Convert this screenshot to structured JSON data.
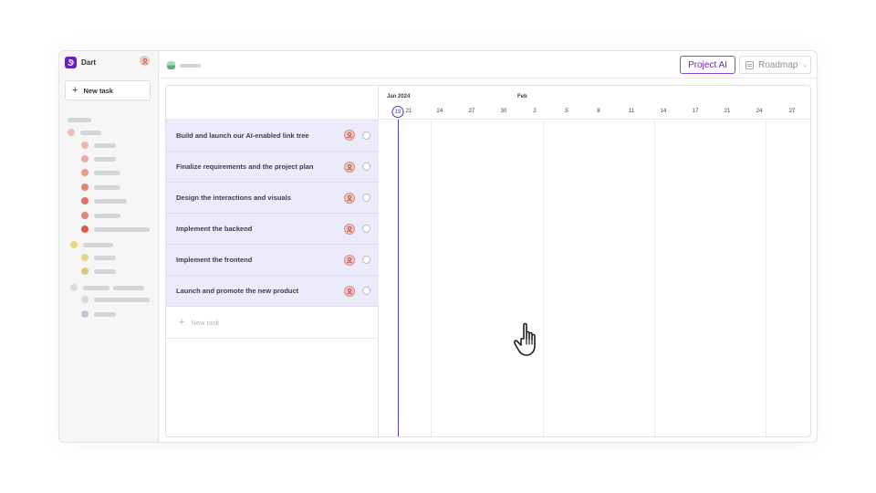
{
  "sidebar": {
    "brand_name": "Dart",
    "new_task_label": "New task",
    "dot_colors": [
      "#f1bcb6",
      "#efb7ae",
      "#edab9f",
      "#e79a8b",
      "#e38676",
      "#e07060",
      "#de5a48",
      "#ebd57a",
      "#e8d583",
      "#ddc77c",
      "#dcdcdf",
      "#d8d9dc",
      "#c5c5d6"
    ]
  },
  "topbar": {
    "project_ai_label": "Project AI",
    "roadmap_label": "Roadmap"
  },
  "tasks": [
    {
      "title": "Build and launch our AI-enabled link tree"
    },
    {
      "title": "Finalize requirements and the project plan"
    },
    {
      "title": "Design the interactions and visuals"
    },
    {
      "title": "Implement the backend"
    },
    {
      "title": "Implement the frontend"
    },
    {
      "title": "Launch and promote the new product"
    }
  ],
  "new_task_row_label": "New task",
  "timeline": {
    "months": [
      {
        "label": "Jan 2024"
      },
      {
        "label": "Feb"
      }
    ],
    "today": "19",
    "days": [
      "21",
      "24",
      "27",
      "30",
      "2",
      "5",
      "8",
      "11",
      "14",
      "17",
      "21",
      "24",
      "27"
    ]
  },
  "colors": {
    "brand": "#6a1fc2",
    "task_row_bg": "#ebebfc",
    "today_line": "#4646c4"
  }
}
